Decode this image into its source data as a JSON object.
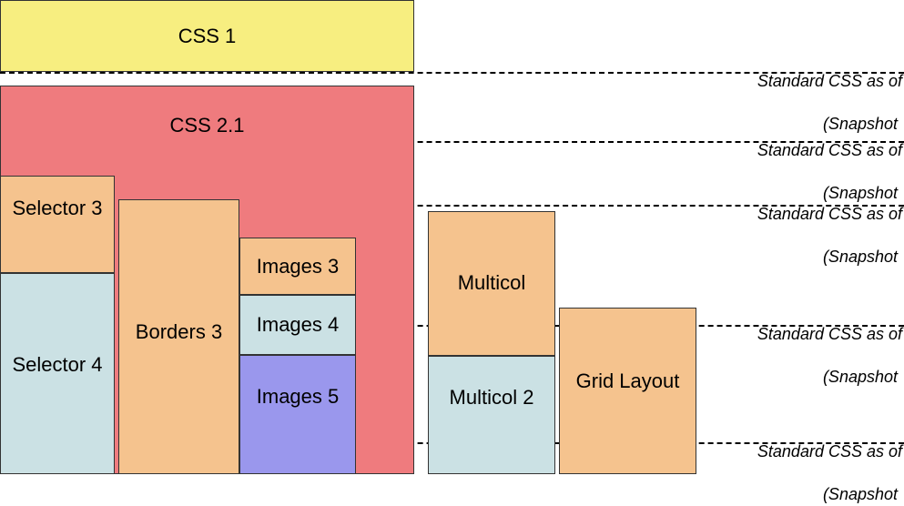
{
  "blocks": {
    "css1": {
      "label": "CSS 1"
    },
    "css21": {
      "label": "CSS 2.1"
    },
    "selector3": {
      "label": "Selector 3"
    },
    "selector4": {
      "label": "Selector 4"
    },
    "borders3": {
      "label": "Borders 3"
    },
    "images3": {
      "label": "Images 3"
    },
    "images4": {
      "label": "Images 4"
    },
    "images5": {
      "label": "Images 5"
    },
    "multicol": {
      "label": "Multicol"
    },
    "multicol2": {
      "label": "Multicol 2"
    },
    "gridlayout": {
      "label": "Grid Layout"
    }
  },
  "milestones": {
    "m1": {
      "line1": "Standard CSS as of",
      "line2": "(Snapshot "
    },
    "m2": {
      "line1": "Standard CSS as of",
      "line2": "(Snapshot "
    },
    "m3": {
      "line1": "Standard CSS as of",
      "line2": "(Snapshot "
    },
    "m4": {
      "line1": "Standard CSS as of",
      "line2": "(Snapshot "
    },
    "m5": {
      "line1": "Standard CSS as of",
      "line2": "(Snapshot "
    }
  }
}
